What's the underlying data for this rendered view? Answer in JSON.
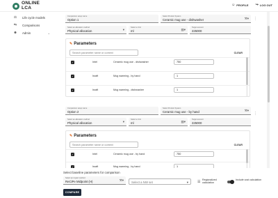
{
  "header": {
    "brand_line1": "ONLINE",
    "brand_line2": "LCA",
    "profile_label": "PROFILE",
    "logout_label": "LOG OUT"
  },
  "sidebar": {
    "items": [
      {
        "label": "Life cycle models",
        "icon": "scale-icon"
      },
      {
        "label": "Comparisons",
        "icon": "compare-icon"
      },
      {
        "label": "Admin",
        "icon": "person-icon"
      }
    ]
  },
  "options": [
    {
      "name_label": "Comparison setup name",
      "name_value": "Option 1",
      "product_label": "Select Product System",
      "product_value": "Ceramic mug use - dishwasher",
      "allocation_label": "Select an allocation method",
      "allocation_value": "Physical allocation",
      "unit_label": "Select a Unit",
      "unit_value": "ml",
      "target_label": "Target amount",
      "target_value": "225000",
      "params_title": "Parameters",
      "search_placeholder": "Search parameter name or context",
      "clear_label": "CLEAR",
      "rows": [
        {
          "type": "Intel",
          "name": "Ceramic mug use - dishwasher",
          "value": "750"
        },
        {
          "type": "Israft",
          "name": "Mug warming - by hand",
          "value": "1"
        },
        {
          "type": "Israft",
          "name": "Mug warming - dishwasher",
          "value": "1"
        }
      ]
    },
    {
      "name_label": "Comparison setup name",
      "name_value": "Option 2",
      "product_label": "Select Product System",
      "product_value": "Ceramic mug use - by hand",
      "allocation_label": "Select an allocation method",
      "allocation_value": "Physical allocation",
      "unit_label": "Select a Unit",
      "unit_value": "ml",
      "target_label": "Target amount",
      "target_value": "225000",
      "params_title": "Parameters",
      "search_placeholder": "Search parameter name or context",
      "clear_label": "CLEAR",
      "rows": [
        {
          "type": "Intel",
          "name": "Ceramic mug use - by hand",
          "value": "750"
        },
        {
          "type": "Israft",
          "name": "Mug warming - by hand",
          "value": "1"
        }
      ]
    }
  ],
  "baseline": {
    "title": "Select baseline parameters for comparison",
    "method_label": "Select an impact method",
    "method_value": "ReCiPe Midpoint (H)",
    "nw_placeholder": "Select a NW set",
    "regionalized_label": "Regionalized calculation",
    "cost_label": "Include cost calculation",
    "compare_label": "COMPARE"
  }
}
